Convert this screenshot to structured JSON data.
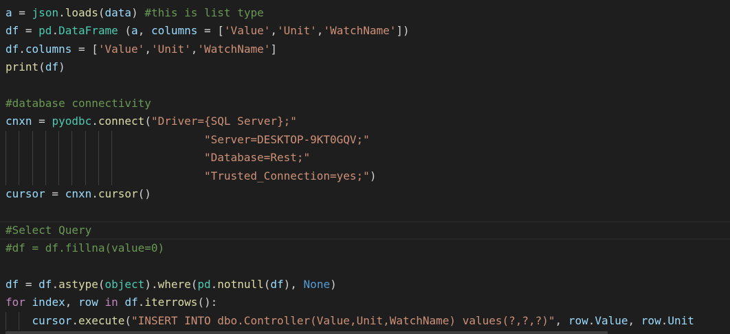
{
  "theme": {
    "background": "#1e1e1e",
    "default": "#d4d4d4",
    "variable": "#9cdcfe",
    "function": "#dcdcaa",
    "class": "#4ec9b0",
    "string": "#ce9178",
    "comment": "#6a9955",
    "keyword": "#c586c0",
    "constant": "#569cd6"
  },
  "editor": {
    "lines": [
      {
        "current": false,
        "guides": 0,
        "tokens": [
          {
            "t": "a",
            "c": "variable"
          },
          {
            "t": " = ",
            "c": "default"
          },
          {
            "t": "json",
            "c": "class"
          },
          {
            "t": ".",
            "c": "default"
          },
          {
            "t": "loads",
            "c": "function"
          },
          {
            "t": "(",
            "c": "default"
          },
          {
            "t": "data",
            "c": "variable"
          },
          {
            "t": ") ",
            "c": "default"
          },
          {
            "t": "#this is list type",
            "c": "comment"
          }
        ]
      },
      {
        "current": false,
        "guides": 0,
        "tokens": [
          {
            "t": "df",
            "c": "variable"
          },
          {
            "t": " = ",
            "c": "default"
          },
          {
            "t": "pd",
            "c": "class"
          },
          {
            "t": ".",
            "c": "default"
          },
          {
            "t": "DataFrame",
            "c": "class"
          },
          {
            "t": " (",
            "c": "default"
          },
          {
            "t": "a",
            "c": "variable"
          },
          {
            "t": ", ",
            "c": "default"
          },
          {
            "t": "columns",
            "c": "variable"
          },
          {
            "t": " = [",
            "c": "default"
          },
          {
            "t": "'Value'",
            "c": "string"
          },
          {
            "t": ",",
            "c": "default"
          },
          {
            "t": "'Unit'",
            "c": "string"
          },
          {
            "t": ",",
            "c": "default"
          },
          {
            "t": "'WatchName'",
            "c": "string"
          },
          {
            "t": "])",
            "c": "default"
          }
        ]
      },
      {
        "current": false,
        "guides": 0,
        "tokens": [
          {
            "t": "df",
            "c": "variable"
          },
          {
            "t": ".",
            "c": "default"
          },
          {
            "t": "columns",
            "c": "variable"
          },
          {
            "t": " = [",
            "c": "default"
          },
          {
            "t": "'Value'",
            "c": "string"
          },
          {
            "t": ",",
            "c": "default"
          },
          {
            "t": "'Unit'",
            "c": "string"
          },
          {
            "t": ",",
            "c": "default"
          },
          {
            "t": "'WatchName'",
            "c": "string"
          },
          {
            "t": "]",
            "c": "default"
          }
        ]
      },
      {
        "current": false,
        "guides": 0,
        "tokens": [
          {
            "t": "print",
            "c": "function"
          },
          {
            "t": "(",
            "c": "default"
          },
          {
            "t": "df",
            "c": "variable"
          },
          {
            "t": ")",
            "c": "default"
          }
        ]
      },
      {
        "current": false,
        "guides": 0,
        "tokens": []
      },
      {
        "current": false,
        "guides": 0,
        "tokens": [
          {
            "t": "#database connectivity",
            "c": "comment"
          }
        ]
      },
      {
        "current": false,
        "guides": 0,
        "tokens": [
          {
            "t": "cnxn",
            "c": "variable"
          },
          {
            "t": " = ",
            "c": "default"
          },
          {
            "t": "pyodbc",
            "c": "class"
          },
          {
            "t": ".",
            "c": "default"
          },
          {
            "t": "connect",
            "c": "function"
          },
          {
            "t": "(",
            "c": "default"
          },
          {
            "t": "\"Driver={SQL Server};\"",
            "c": "string"
          }
        ]
      },
      {
        "current": false,
        "guides": 9,
        "tokens": [
          {
            "t": "                              ",
            "c": "default"
          },
          {
            "t": "\"Server=DESKTOP-9KT0GQV;\"",
            "c": "string"
          }
        ]
      },
      {
        "current": false,
        "guides": 9,
        "tokens": [
          {
            "t": "                              ",
            "c": "default"
          },
          {
            "t": "\"Database=Rest;\"",
            "c": "string"
          }
        ]
      },
      {
        "current": false,
        "guides": 9,
        "tokens": [
          {
            "t": "                              ",
            "c": "default"
          },
          {
            "t": "\"Trusted_Connection=yes;\"",
            "c": "string"
          },
          {
            "t": ")",
            "c": "default"
          }
        ]
      },
      {
        "current": false,
        "guides": 0,
        "tokens": [
          {
            "t": "cursor",
            "c": "variable"
          },
          {
            "t": " = ",
            "c": "default"
          },
          {
            "t": "cnxn",
            "c": "variable"
          },
          {
            "t": ".",
            "c": "default"
          },
          {
            "t": "cursor",
            "c": "function"
          },
          {
            "t": "()",
            "c": "default"
          }
        ]
      },
      {
        "current": false,
        "guides": 0,
        "tokens": []
      },
      {
        "current": true,
        "guides": 0,
        "tokens": [
          {
            "t": "#Select Query",
            "c": "comment"
          }
        ]
      },
      {
        "current": false,
        "guides": 0,
        "tokens": [
          {
            "t": "#df = df.fillna(value=0)",
            "c": "comment"
          }
        ]
      },
      {
        "current": false,
        "guides": 0,
        "tokens": []
      },
      {
        "current": false,
        "guides": 0,
        "tokens": [
          {
            "t": "df",
            "c": "variable"
          },
          {
            "t": " = ",
            "c": "default"
          },
          {
            "t": "df",
            "c": "variable"
          },
          {
            "t": ".",
            "c": "default"
          },
          {
            "t": "astype",
            "c": "function"
          },
          {
            "t": "(",
            "c": "default"
          },
          {
            "t": "object",
            "c": "class"
          },
          {
            "t": ").",
            "c": "default"
          },
          {
            "t": "where",
            "c": "function"
          },
          {
            "t": "(",
            "c": "default"
          },
          {
            "t": "pd",
            "c": "class"
          },
          {
            "t": ".",
            "c": "default"
          },
          {
            "t": "notnull",
            "c": "function"
          },
          {
            "t": "(",
            "c": "default"
          },
          {
            "t": "df",
            "c": "variable"
          },
          {
            "t": "), ",
            "c": "default"
          },
          {
            "t": "None",
            "c": "constant"
          },
          {
            "t": ")",
            "c": "default"
          }
        ]
      },
      {
        "current": false,
        "guides": 0,
        "tokens": [
          {
            "t": "for",
            "c": "keyword"
          },
          {
            "t": " ",
            "c": "default"
          },
          {
            "t": "index",
            "c": "variable"
          },
          {
            "t": ", ",
            "c": "default"
          },
          {
            "t": "row",
            "c": "variable"
          },
          {
            "t": " ",
            "c": "default"
          },
          {
            "t": "in",
            "c": "keyword"
          },
          {
            "t": " ",
            "c": "default"
          },
          {
            "t": "df",
            "c": "variable"
          },
          {
            "t": ".",
            "c": "default"
          },
          {
            "t": "iterrows",
            "c": "function"
          },
          {
            "t": "():",
            "c": "default"
          }
        ]
      },
      {
        "current": false,
        "guides": 2,
        "tokens": [
          {
            "t": "    ",
            "c": "default"
          },
          {
            "t": "cursor",
            "c": "variable"
          },
          {
            "t": ".",
            "c": "default"
          },
          {
            "t": "execute",
            "c": "function"
          },
          {
            "t": "(",
            "c": "default"
          },
          {
            "t": "\"INSERT INTO dbo.Controller(Value,Unit,WatchName) values(?,?,?)\"",
            "c": "string"
          },
          {
            "t": ", ",
            "c": "default"
          },
          {
            "t": "row",
            "c": "variable"
          },
          {
            "t": ".",
            "c": "default"
          },
          {
            "t": "Value",
            "c": "variable"
          },
          {
            "t": ", ",
            "c": "default"
          },
          {
            "t": "row",
            "c": "variable"
          },
          {
            "t": ".",
            "c": "default"
          },
          {
            "t": "Unit",
            "c": "variable"
          }
        ]
      }
    ]
  }
}
